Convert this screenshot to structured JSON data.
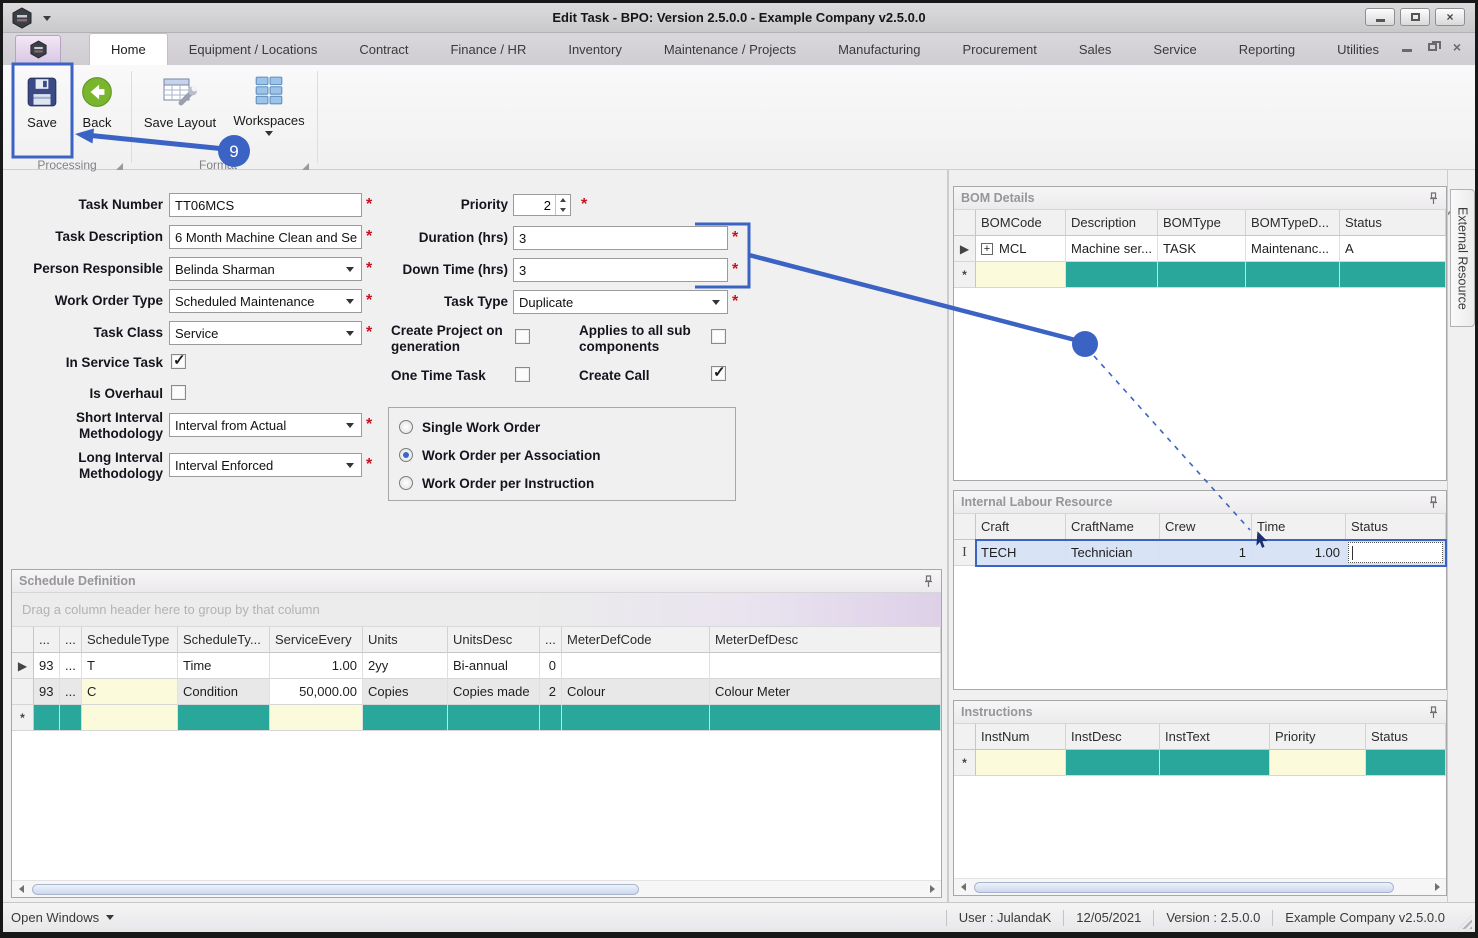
{
  "window": {
    "title": "Edit Task - BPO: Version 2.5.0.0 - Example Company v2.5.0.0"
  },
  "tabs": [
    "Home",
    "Equipment / Locations",
    "Contract",
    "Finance / HR",
    "Inventory",
    "Maintenance / Projects",
    "Manufacturing",
    "Procurement",
    "Sales",
    "Service",
    "Reporting",
    "Utilities"
  ],
  "ribbon": {
    "save": "Save",
    "back": "Back",
    "save_layout": "Save Layout",
    "workspaces": "Workspaces",
    "group1": "Processing",
    "group2": "Format"
  },
  "annotation": {
    "step": "9"
  },
  "form": {
    "task_number_label": "Task Number",
    "task_number": "TT06MCS",
    "task_description_label": "Task Description",
    "task_description": "6 Month Machine Clean and Se",
    "person_responsible_label": "Person Responsible",
    "person_responsible": "Belinda Sharman",
    "work_order_type_label": "Work Order Type",
    "work_order_type": "Scheduled Maintenance",
    "task_class_label": "Task Class",
    "task_class": "Service",
    "in_service_task_label": "In Service Task",
    "in_service_task_checked": true,
    "is_overhaul_label": "Is Overhaul",
    "is_overhaul_checked": false,
    "short_interval_label": "Short Interval Methodology",
    "short_interval": "Interval from Actual",
    "long_interval_label": "Long Interval Methodology",
    "long_interval": "Interval Enforced",
    "priority_label": "Priority",
    "priority": "2",
    "duration_label": "Duration (hrs)",
    "duration": "3",
    "down_time_label": "Down Time (hrs)",
    "down_time": "3",
    "task_type_label": "Task Type",
    "task_type": "Duplicate",
    "create_project_label": "Create Project on generation",
    "create_project_checked": false,
    "applies_sub_label": "Applies to all sub components",
    "applies_sub_checked": false,
    "one_time_label": "One Time Task",
    "one_time_checked": false,
    "create_call_label": "Create Call",
    "create_call_checked": true,
    "wo1": "Single Work Order",
    "wo2": "Work Order per Association",
    "wo3": "Work Order per Instruction",
    "wo_selected": "Work Order per Association",
    "required_marker": "*"
  },
  "bom": {
    "title": "BOM Details",
    "col0": "BOMCode",
    "col1": "Description",
    "col2": "BOMType",
    "col3": "BOMTypeD...",
    "col4": "Status",
    "r_code": "MCL",
    "r_desc": "Machine ser...",
    "r_type": "TASK",
    "r_typed": "Maintenanc...",
    "r_status": "A"
  },
  "labour": {
    "title": "Internal Labour Resource",
    "col0": "Craft",
    "col1": "CraftName",
    "col2": "Crew",
    "col3": "Time",
    "col4": "Status",
    "r_craft": "TECH",
    "r_name": "Technician",
    "r_crew": "1",
    "r_time": "1.00",
    "r_status": ""
  },
  "instructions": {
    "title": "Instructions",
    "col0": "InstNum",
    "col1": "InstDesc",
    "col2": "InstText",
    "col3": "Priority",
    "col4": "Status"
  },
  "schedule": {
    "title": "Schedule Definition",
    "hint": "Drag a column header here to group by that column",
    "colA": "...",
    "colB": "...",
    "col0": "ScheduleType",
    "col1": "ScheduleTy...",
    "col2": "ServiceEvery",
    "col3": "Units",
    "col4": "UnitsDesc",
    "colC": "...",
    "col5": "MeterDefCode",
    "col6": "MeterDefDesc",
    "r1": {
      "a": "93",
      "b": "...",
      "type": "T",
      "typedesc": "Time",
      "every": "1.00",
      "units": "2yy",
      "unitsdesc": "Bi-annual",
      "c": "0",
      "metercode": "",
      "meterdesc": ""
    },
    "r2": {
      "a": "93",
      "b": "...",
      "type": "C",
      "typedesc": "Condition",
      "every": "50,000.00",
      "units": "Copies",
      "unitsdesc": "Copies made",
      "c": "2",
      "metercode": "Colour",
      "meterdesc": "Colour Meter"
    }
  },
  "side_tab": {
    "label": "External Resource"
  },
  "statusbar": {
    "open_windows": "Open Windows",
    "user": "User : JulandaK",
    "date": "12/05/2021",
    "version": "Version : 2.5.0.0",
    "company": "Example Company v2.5.0.0"
  },
  "icons": {
    "row_current": "▶",
    "row_new": "*",
    "row_edit": "I",
    "expand_plus": "+",
    "close": "×"
  },
  "colors": {
    "annotation_blue": "#3b63c4",
    "teal_cell": "#2aa79b",
    "yellow_cell": "#fbfada",
    "selected_row": "#d8e4f6",
    "required_red": "#c81220"
  }
}
